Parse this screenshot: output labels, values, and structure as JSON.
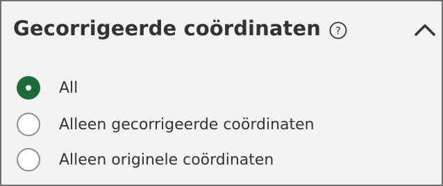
{
  "filter": {
    "title": "Gecorrigeerde coördinaten",
    "help_icon": "question-circle-icon",
    "collapse_icon": "chevron-up-icon",
    "options": [
      {
        "label": "All",
        "selected": true
      },
      {
        "label": "Alleen gecorrigeerde coördinaten",
        "selected": false
      },
      {
        "label": "Alleen originele coördinaten",
        "selected": false
      }
    ]
  },
  "colors": {
    "selected_radio": "#1e6a3a",
    "panel_background": "#f3f3f3",
    "panel_border": "#707070",
    "text": "#333333"
  }
}
